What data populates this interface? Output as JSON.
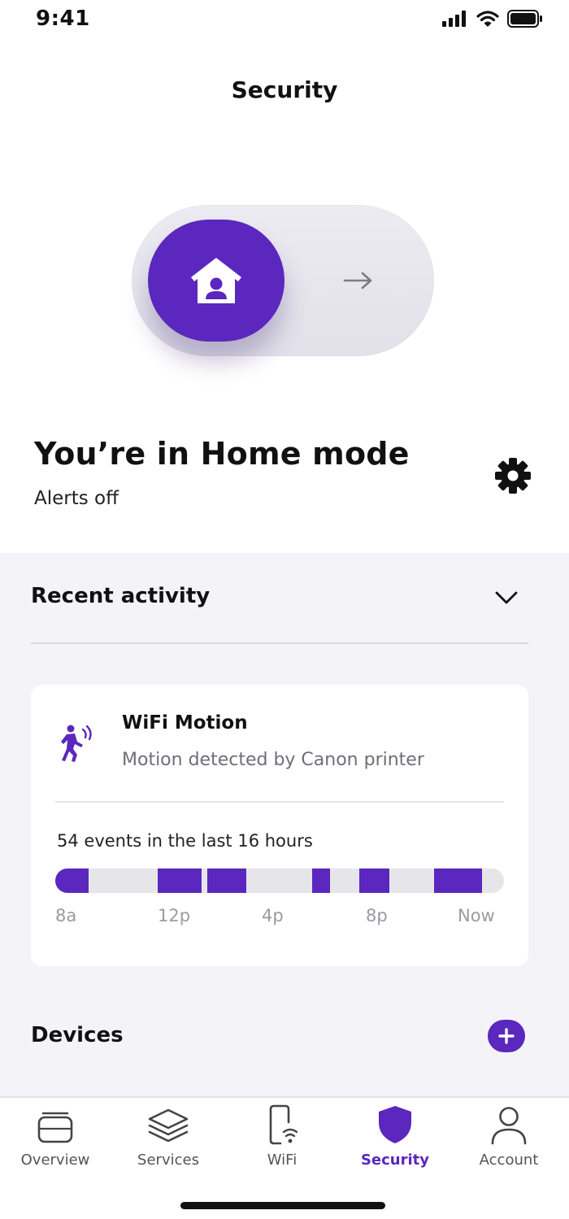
{
  "status_bar": {
    "time": "9:41"
  },
  "header": {
    "title": "Security"
  },
  "mode": {
    "title": "You’re in Home mode",
    "subtitle": "Alerts off"
  },
  "recent_activity": {
    "title": "Recent activity",
    "card": {
      "title": "WiFi Motion",
      "subtitle": "Motion detected by Canon printer",
      "events_label": "54 events in the last 16 hours",
      "ticks": [
        "8a",
        "12p",
        "4p",
        "8p",
        "Now"
      ]
    }
  },
  "devices": {
    "title": "Devices"
  },
  "nav": {
    "items": [
      {
        "label": "Overview"
      },
      {
        "label": "Services"
      },
      {
        "label": "WiFi"
      },
      {
        "label": "Security"
      },
      {
        "label": "Account"
      }
    ]
  },
  "colors": {
    "accent": "#5b27be",
    "track": "#e6e6ea",
    "section_bg": "#f4f4f8"
  },
  "icons": [
    "signal-icon",
    "wifi-icon",
    "battery-icon",
    "home-person-icon",
    "arrow-right-icon",
    "gear-icon",
    "chevron-down-icon",
    "motion-icon",
    "plus-icon",
    "overview-icon",
    "services-icon",
    "wifi-nav-icon",
    "security-shield-icon",
    "account-icon"
  ]
}
